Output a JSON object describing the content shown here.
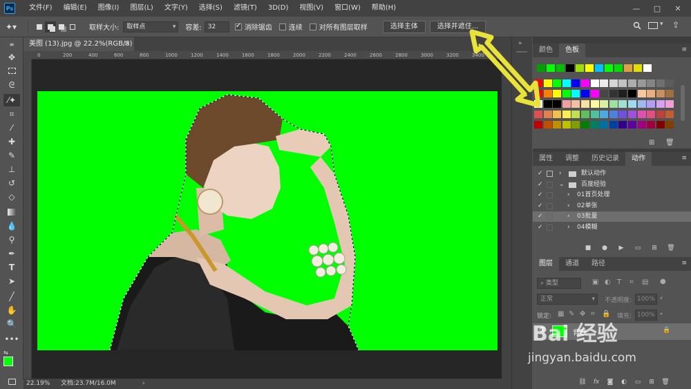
{
  "app": {
    "logo": "Ps"
  },
  "menu": [
    "文件(F)",
    "编辑(E)",
    "图像(I)",
    "图层(L)",
    "文字(Y)",
    "选择(S)",
    "滤镜(T)",
    "3D(D)",
    "视图(V)",
    "窗口(W)",
    "帮助(H)"
  ],
  "window_controls": {
    "minimize": "—",
    "restore": "□",
    "close": "✕"
  },
  "options": {
    "sample_size_label": "取样大小:",
    "sample_size_value": "取样点",
    "tolerance_label": "容差:",
    "tolerance_value": "32",
    "antialias_label": "消除锯齿",
    "contiguous_label": "连续",
    "all_layers_label": "对所有图层取样",
    "select_subject_label": "选择主体",
    "select_mask_label": "选择并遮住..."
  },
  "document": {
    "tab_title": "美图 (13).jpg @ 22.2%(RGB/8)",
    "ruler_ticks": [
      "0",
      "200",
      "400",
      "600",
      "800",
      "1000",
      "1200",
      "1400",
      "1600",
      "1800",
      "2000",
      "2200",
      "2400",
      "2600",
      "2800",
      "3000",
      "3200",
      "3400"
    ]
  },
  "status": {
    "zoom": "22.19%",
    "doc_size": "文档:23.7M/16.0M"
  },
  "color_panel": {
    "tabs": [
      "颜色",
      "色板"
    ],
    "active_tab": "色板",
    "swatches_row1": [
      "#00a000",
      "#00ff00",
      "#00c000",
      "#000000",
      "#9be000",
      "#ffff00",
      "#00c0ff",
      "#00ff00",
      "#00e000",
      "#e0a040",
      "#e0e000",
      "#ffffff"
    ],
    "swatch_grid": [
      [
        "#ff0000",
        "#ffff00",
        "#00ff00",
        "#00ffff",
        "#0000ff",
        "#ff00ff",
        "#ffffff",
        "#ebebeb",
        "#d6d6d6",
        "#c2c2c2",
        "#adadad",
        "#999999",
        "#858585",
        "#707070",
        "#5c5c5c"
      ],
      [
        "#ff0000",
        "#ff7f00",
        "#ffff00",
        "#00ff00",
        "#00ffff",
        "#0000ff",
        "#ff00ff",
        "#474747",
        "#333333",
        "#1f1f1f",
        "#000000",
        "#f5c8a0",
        "#e8b080",
        "#c89060",
        "#a07040"
      ],
      [
        "#ffffff",
        "#000000",
        "#000000",
        "#f0a0a0",
        "#f0c0a0",
        "#f8e0a0",
        "#fffaa0",
        "#d8f0a0",
        "#a0e0a0",
        "#a0e0d0",
        "#a0d8f0",
        "#a0b8f0",
        "#b0a0f0",
        "#d8a0f0",
        "#f0a0d8"
      ],
      [
        "#e05050",
        "#e08050",
        "#f0c050",
        "#f8f050",
        "#c0e050",
        "#60c060",
        "#50c0a0",
        "#50a8e0",
        "#5080e0",
        "#7050e0",
        "#a050e0",
        "#e050b0",
        "#e05080",
        "#c04040",
        "#c06030"
      ],
      [
        "#c00000",
        "#c05000",
        "#c09000",
        "#c0c000",
        "#80a000",
        "#008000",
        "#008060",
        "#0070a0",
        "#0040a0",
        "#300090",
        "#6000a0",
        "#a00080",
        "#a00040",
        "#800000",
        "#804000"
      ]
    ]
  },
  "actions_panel": {
    "tabs": [
      "属性",
      "调整",
      "历史记录",
      "动作"
    ],
    "active_tab": "动作",
    "rows": [
      {
        "label": "默认动作",
        "type": "folder",
        "level": 0,
        "expanded": false,
        "selected": false
      },
      {
        "label": "百度经验",
        "type": "folder",
        "level": 0,
        "expanded": true,
        "selected": false
      },
      {
        "label": "01首页处理",
        "type": "action",
        "level": 1,
        "selected": false
      },
      {
        "label": "02单张",
        "type": "action",
        "level": 1,
        "selected": false
      },
      {
        "label": "03批量",
        "type": "action",
        "level": 1,
        "selected": true
      },
      {
        "label": "04模糊",
        "type": "action",
        "level": 1,
        "selected": false
      }
    ]
  },
  "layers_panel": {
    "tabs": [
      "图层",
      "通道",
      "路径"
    ],
    "active_tab": "图层",
    "filter_placeholder": "类型",
    "blend_mode": "正常",
    "opacity_label": "不透明度:",
    "opacity_value": "100%",
    "lock_label": "锁定:",
    "fill_label": "填充:",
    "fill_value": "100%",
    "layer_name": "背景"
  },
  "watermark": {
    "text": "Bai 经验",
    "url": "jingyan.baidu.com"
  },
  "colors": {
    "accent": "#00ff00",
    "bg": "#535353",
    "panel_dark": "#424242",
    "arrow": "#e8e23a"
  }
}
